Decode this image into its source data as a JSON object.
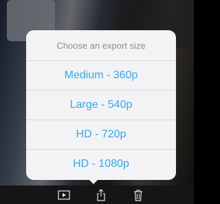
{
  "export_sheet": {
    "title": "Choose an export size",
    "options": [
      {
        "label": "Medium - 360p"
      },
      {
        "label": "Large - 540p"
      },
      {
        "label": "HD - 720p"
      },
      {
        "label": "HD - 1080p"
      }
    ]
  },
  "toolbar": {
    "icons": [
      "play-icon",
      "share-icon",
      "trash-icon"
    ]
  },
  "colors": {
    "accent": "#36a7e6",
    "sheet_background": "#f3f3f5",
    "title_text": "#8d8d92"
  }
}
